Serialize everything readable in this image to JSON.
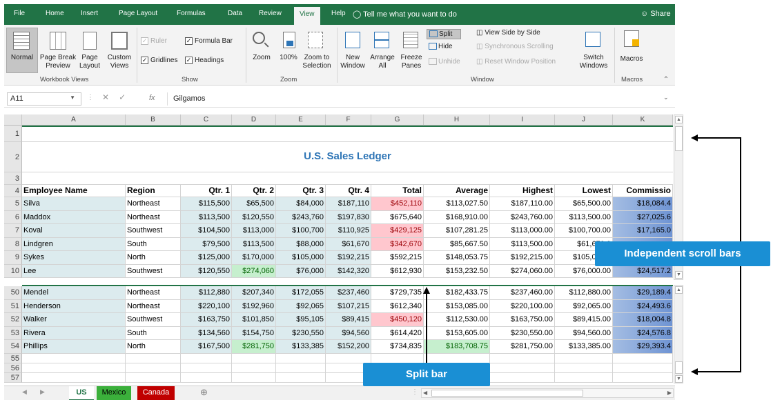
{
  "ribbon_tabs": [
    "File",
    "Home",
    "Insert",
    "Page Layout",
    "Formulas",
    "Data",
    "Review",
    "View",
    "Help"
  ],
  "active_tab": "View",
  "tell_me": "Tell me what you want to do",
  "share": "Share",
  "ribbon": {
    "workbook_views": {
      "normal": "Normal",
      "page_break_1": "Page Break",
      "page_break_2": "Preview",
      "page_layout_1": "Page",
      "page_layout_2": "Layout",
      "custom_1": "Custom",
      "custom_2": "Views",
      "label": "Workbook Views"
    },
    "show": {
      "ruler": "Ruler",
      "formula_bar": "Formula Bar",
      "gridlines": "Gridlines",
      "headings": "Headings",
      "label": "Show"
    },
    "zoom": {
      "zoom": "Zoom",
      "hundred": "100%",
      "zoom_sel_1": "Zoom to",
      "zoom_sel_2": "Selection",
      "label": "Zoom"
    },
    "window": {
      "new_1": "New",
      "new_2": "Window",
      "arrange_1": "Arrange",
      "arrange_2": "All",
      "freeze_1": "Freeze",
      "freeze_2": "Panes",
      "split": "Split",
      "hide": "Hide",
      "unhide": "Unhide",
      "side_by_side": "View Side by Side",
      "sync_scroll": "Synchronous Scrolling",
      "reset_pos": "Reset Window Position",
      "switch_1": "Switch",
      "switch_2": "Windows",
      "label": "Window"
    },
    "macros": {
      "macros": "Macros",
      "label": "Macros"
    }
  },
  "formula_bar": {
    "name_box": "A11",
    "fx": "fx",
    "value": "Gilgamos"
  },
  "columns": [
    "A",
    "B",
    "C",
    "D",
    "E",
    "F",
    "G",
    "H",
    "I",
    "J",
    "K"
  ],
  "title": "U.S. Sales Ledger",
  "headers": [
    "Employee Name",
    "Region",
    "Qtr. 1",
    "Qtr. 2",
    "Qtr. 3",
    "Qtr. 4",
    "Total",
    "Average",
    "Highest",
    "Lowest",
    "Commissio"
  ],
  "top_rows": [
    {
      "row": "5",
      "cells": [
        "Silva",
        "Northeast",
        "$115,500",
        "$65,500",
        "$84,000",
        "$187,110",
        "$452,110",
        "$113,027.50",
        "$187,110.00",
        "$65,500.00",
        "$18,084.4"
      ]
    },
    {
      "row": "6",
      "cells": [
        "Maddox",
        "Northeast",
        "$113,500",
        "$120,550",
        "$243,760",
        "$197,830",
        "$675,640",
        "$168,910.00",
        "$243,760.00",
        "$113,500.00",
        "$27,025.6"
      ]
    },
    {
      "row": "7",
      "cells": [
        "Koval",
        "Southwest",
        "$104,500",
        "$113,000",
        "$100,700",
        "$110,925",
        "$429,125",
        "$107,281.25",
        "$113,000.00",
        "$100,700.00",
        "$17,165.0"
      ]
    },
    {
      "row": "8",
      "cells": [
        "Lindgren",
        "South",
        "$79,500",
        "$113,500",
        "$88,000",
        "$61,670",
        "$342,670",
        "$85,667.50",
        "$113,500.00",
        "$61,670.0",
        ""
      ]
    },
    {
      "row": "9",
      "cells": [
        "Sykes",
        "North",
        "$125,000",
        "$170,000",
        "$105,000",
        "$192,215",
        "$592,215",
        "$148,053.75",
        "$192,215.00",
        "$105,000.0",
        ""
      ]
    },
    {
      "row": "10",
      "cells": [
        "Lee",
        "Southwest",
        "$120,550",
        "$274,060",
        "$76,000",
        "$142,320",
        "$612,930",
        "$153,232.50",
        "$274,060.00",
        "$76,000.00",
        "$24,517.2"
      ]
    }
  ],
  "bottom_rows": [
    {
      "row": "50",
      "cells": [
        "Mendel",
        "Northeast",
        "$112,880",
        "$207,340",
        "$172,055",
        "$237,460",
        "$729,735",
        "$182,433.75",
        "$237,460.00",
        "$112,880.00",
        "$29,189.4"
      ]
    },
    {
      "row": "51",
      "cells": [
        "Henderson",
        "Northeast",
        "$220,100",
        "$192,960",
        "$92,065",
        "$107,215",
        "$612,340",
        "$153,085.00",
        "$220,100.00",
        "$92,065.00",
        "$24,493.6"
      ]
    },
    {
      "row": "52",
      "cells": [
        "Walker",
        "Southwest",
        "$163,750",
        "$101,850",
        "$95,105",
        "$89,415",
        "$450,120",
        "$112,530.00",
        "$163,750.00",
        "$89,415.00",
        "$18,004.8"
      ]
    },
    {
      "row": "53",
      "cells": [
        "Rivera",
        "South",
        "$134,560",
        "$154,750",
        "$230,550",
        "$94,560",
        "$614,420",
        "$153,605.00",
        "$230,550.00",
        "$94,560.00",
        "$24,576.8"
      ]
    },
    {
      "row": "54",
      "cells": [
        "Phillips",
        "North",
        "$167,500",
        "$281,750",
        "$133,385",
        "$152,200",
        "$734,835",
        "$183,708.75",
        "$281,750.00",
        "$133,385.00",
        "$29,393.4"
      ]
    }
  ],
  "sheet_tabs": [
    "US",
    "Mexico",
    "Canada"
  ],
  "callouts": {
    "scroll": "Independent scroll bars",
    "split": "Split bar"
  },
  "colors": {
    "excel_green": "#217346",
    "callout_blue": "#1a8fd4",
    "title_blue": "#2e75b6",
    "mexico_tab": "#3bb03b",
    "canada_tab": "#c00000"
  }
}
